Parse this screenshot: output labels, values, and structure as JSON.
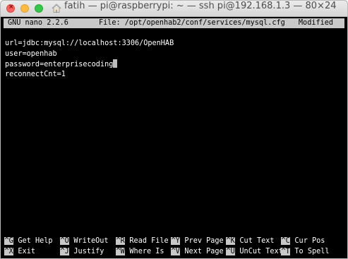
{
  "window": {
    "title": "fatih — pi@raspberrypi: ~ — ssh pi@192.168.1.3 — 80×24"
  },
  "nano": {
    "version": "GNU nano 2.2.6",
    "file": "File: /opt/openhab2/conf/services/mysql.cfg",
    "status": "Modified"
  },
  "buffer": {
    "lines": [
      "url=jdbc:mysql://localhost:3306/OpenHAB",
      "user=openhab",
      "password=enterprisecoding",
      "reconnectCnt=1"
    ]
  },
  "shortcuts": {
    "row1": [
      {
        "key": "^G",
        "label": "Get Help"
      },
      {
        "key": "^O",
        "label": "WriteOut"
      },
      {
        "key": "^R",
        "label": "Read File"
      },
      {
        "key": "^Y",
        "label": "Prev Page"
      },
      {
        "key": "^K",
        "label": "Cut Text"
      },
      {
        "key": "^C",
        "label": "Cur Pos"
      }
    ],
    "row2": [
      {
        "key": "^X",
        "label": "Exit"
      },
      {
        "key": "^J",
        "label": "Justify"
      },
      {
        "key": "^W",
        "label": "Where Is"
      },
      {
        "key": "^V",
        "label": "Next Page"
      },
      {
        "key": "^U",
        "label": "UnCut Text"
      },
      {
        "key": "^T",
        "label": "To Spell"
      }
    ]
  }
}
